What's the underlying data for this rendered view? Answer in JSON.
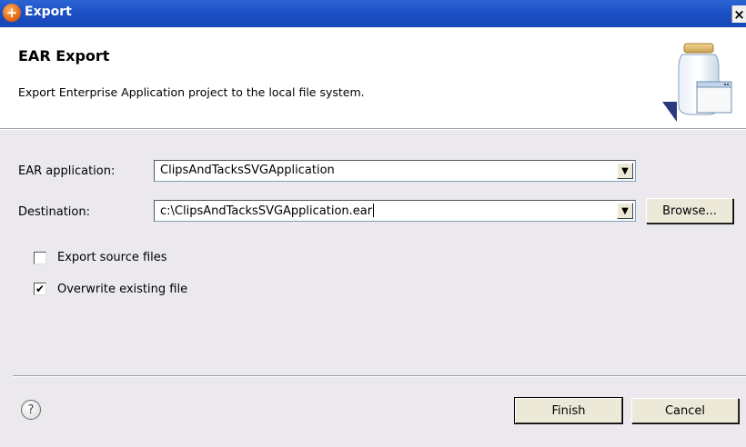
{
  "window": {
    "title": "Export",
    "close_glyph": "×"
  },
  "header": {
    "title": "EAR Export",
    "description": "Export Enterprise Application project to the local file system.",
    "banner_icon": "jar-export-icon"
  },
  "form": {
    "ear_application_label": "EAR application:",
    "ear_application_value": "ClipsAndTacksSVGApplication",
    "destination_label": "Destination:",
    "destination_value": "c:\\ClipsAndTacksSVGApplication.ear",
    "browse_label": "Browse...",
    "export_source_label": "Export source files",
    "export_source_checked": false,
    "overwrite_label": "Overwrite existing file",
    "overwrite_checked": true,
    "check_glyph": "✔"
  },
  "footer": {
    "help_glyph": "?",
    "finish_label": "Finish",
    "cancel_label": "Cancel"
  }
}
